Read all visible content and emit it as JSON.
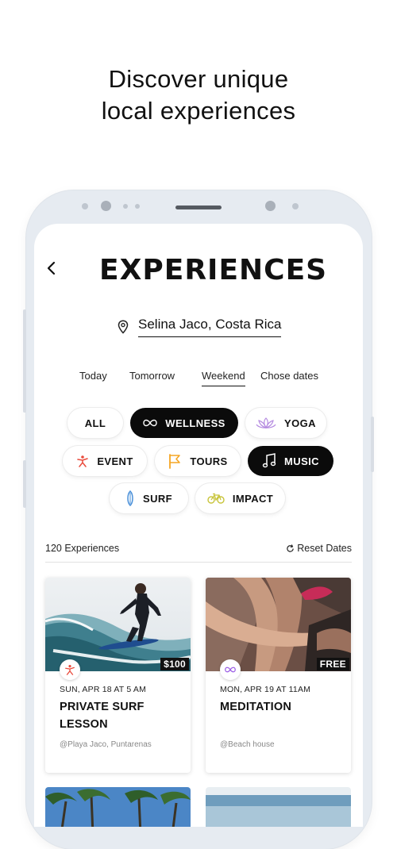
{
  "headline": {
    "line1": "Discover unique",
    "line2": "local experiences"
  },
  "screen": {
    "logo": "EXPERIENCES",
    "location": "Selina Jaco, Costa Rica",
    "date_tabs": [
      "Today",
      "Tomorrow",
      "Weekend",
      "Chose dates"
    ],
    "active_date_tab": "Weekend",
    "categories": {
      "all": "ALL",
      "wellness": "WELLNESS",
      "yoga": "YOGA",
      "event": "EVENT",
      "tours": "TOURS",
      "music": "MUSIC",
      "surf": "SURF",
      "impact": "IMPACT"
    },
    "selected_categories": [
      "WELLNESS",
      "MUSIC"
    ],
    "count_label": "120 Experiences",
    "reset_label": "Reset Dates",
    "cards": [
      {
        "price": "$100",
        "date": "SUN, APR 18 AT 5 AM",
        "title": "PRIVATE SURF LESSON",
        "place": "@Playa Jaco, Puntarenas",
        "icon": "surf-person-icon"
      },
      {
        "price": "FREE",
        "date": "MON, APR 19 AT 11AM",
        "title": "MEDITATION",
        "place": "@Beach house",
        "icon": "infinity-icon"
      }
    ]
  },
  "colors": {
    "accent_orange": "#f5a623",
    "yoga_purple": "#b58be0",
    "event_red": "#e94b3c",
    "surf_blue": "#4a90d9",
    "impact_yellow": "#c8c43a",
    "dark_chip": "#0b0b0b"
  }
}
